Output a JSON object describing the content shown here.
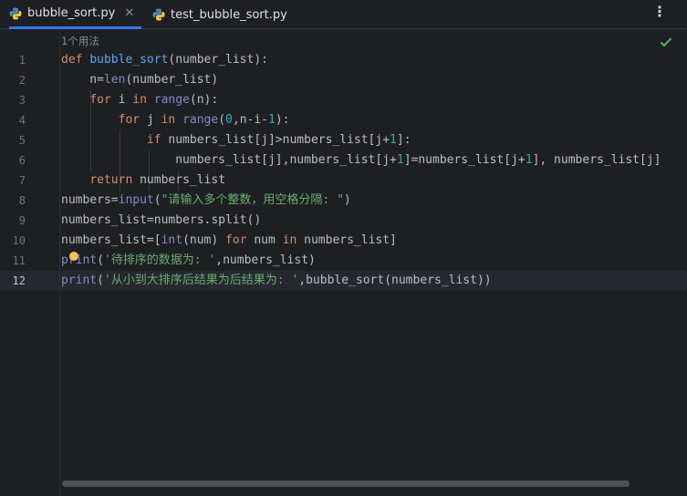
{
  "tabs": [
    {
      "label": "bubble_sort.py",
      "active": true,
      "closable": true
    },
    {
      "label": "test_bubble_sort.py",
      "active": false,
      "closable": false
    }
  ],
  "inlay_hint": "1个用法",
  "line_numbers": [
    "1",
    "2",
    "3",
    "4",
    "5",
    "6",
    "7",
    "8",
    "9",
    "10",
    "11",
    "12"
  ],
  "current_line": "12",
  "code": [
    [
      {
        "t": "def ",
        "c": "kw"
      },
      {
        "t": "bubble_sort",
        "c": "fn"
      },
      {
        "t": "(number_list):",
        "c": ""
      }
    ],
    [
      {
        "t": "    n=",
        "c": ""
      },
      {
        "t": "len",
        "c": "bi"
      },
      {
        "t": "(number_list)",
        "c": ""
      }
    ],
    [
      {
        "t": "    ",
        "c": ""
      },
      {
        "t": "for ",
        "c": "kw"
      },
      {
        "t": "i ",
        "c": ""
      },
      {
        "t": "in ",
        "c": "kw"
      },
      {
        "t": "range",
        "c": "bi"
      },
      {
        "t": "(n):",
        "c": ""
      }
    ],
    [
      {
        "t": "        ",
        "c": ""
      },
      {
        "t": "for ",
        "c": "kw"
      },
      {
        "t": "j ",
        "c": ""
      },
      {
        "t": "in ",
        "c": "kw"
      },
      {
        "t": "range",
        "c": "bi"
      },
      {
        "t": "(",
        "c": ""
      },
      {
        "t": "0",
        "c": "num"
      },
      {
        "t": ",n-i-",
        "c": ""
      },
      {
        "t": "1",
        "c": "num"
      },
      {
        "t": "):",
        "c": ""
      }
    ],
    [
      {
        "t": "            ",
        "c": ""
      },
      {
        "t": "if ",
        "c": "kw"
      },
      {
        "t": "numbers_list[j]>numbers_list[j+",
        "c": ""
      },
      {
        "t": "1",
        "c": "num"
      },
      {
        "t": "]:",
        "c": ""
      }
    ],
    [
      {
        "t": "                numbers_list[j],numbers_list[j+",
        "c": ""
      },
      {
        "t": "1",
        "c": "num"
      },
      {
        "t": "]=numbers_list[j+",
        "c": ""
      },
      {
        "t": "1",
        "c": "num"
      },
      {
        "t": "], numbers_list[j]",
        "c": ""
      }
    ],
    [
      {
        "t": "    ",
        "c": ""
      },
      {
        "t": "return ",
        "c": "kw"
      },
      {
        "t": "numbers_list",
        "c": ""
      }
    ],
    [
      {
        "t": "numbers=",
        "c": ""
      },
      {
        "t": "input",
        "c": "bi"
      },
      {
        "t": "(",
        "c": ""
      },
      {
        "t": "\"请输入多个整数，用空格分隔: \"",
        "c": "str"
      },
      {
        "t": ")",
        "c": ""
      }
    ],
    [
      {
        "t": "numbers_list=numbers.split()",
        "c": ""
      }
    ],
    [
      {
        "t": "numbers_list=[",
        "c": ""
      },
      {
        "t": "int",
        "c": "bi"
      },
      {
        "t": "(num) ",
        "c": ""
      },
      {
        "t": "for ",
        "c": "kw"
      },
      {
        "t": "num ",
        "c": ""
      },
      {
        "t": "in ",
        "c": "kw"
      },
      {
        "t": "numbers_list]",
        "c": ""
      }
    ],
    [
      {
        "t": "print",
        "c": "bi"
      },
      {
        "t": "(",
        "c": ""
      },
      {
        "t": "'待排序的数据为: '",
        "c": "str"
      },
      {
        "t": ",numbers_list)",
        "c": ""
      }
    ],
    [
      {
        "t": "print",
        "c": "bi"
      },
      {
        "t": "(",
        "c": ""
      },
      {
        "t": "'从小到大排序后结果为后结果为: '",
        "c": "str"
      },
      {
        "t": ",bubble_sort(numbers_list))",
        "c": ""
      }
    ]
  ],
  "icons": {
    "tab_file": "python-icon",
    "close": "close-icon",
    "more": "more-vertical-icon",
    "status": "check-icon",
    "intention": "lightbulb-icon"
  },
  "colors": {
    "background": "#1e1f22",
    "keyword": "#cf8e6d",
    "function": "#56a8f5",
    "builtin": "#8888c6",
    "number": "#2aacb8",
    "string": "#6aab73",
    "tab_underline": "#3574f0",
    "check": "#5fb865"
  }
}
